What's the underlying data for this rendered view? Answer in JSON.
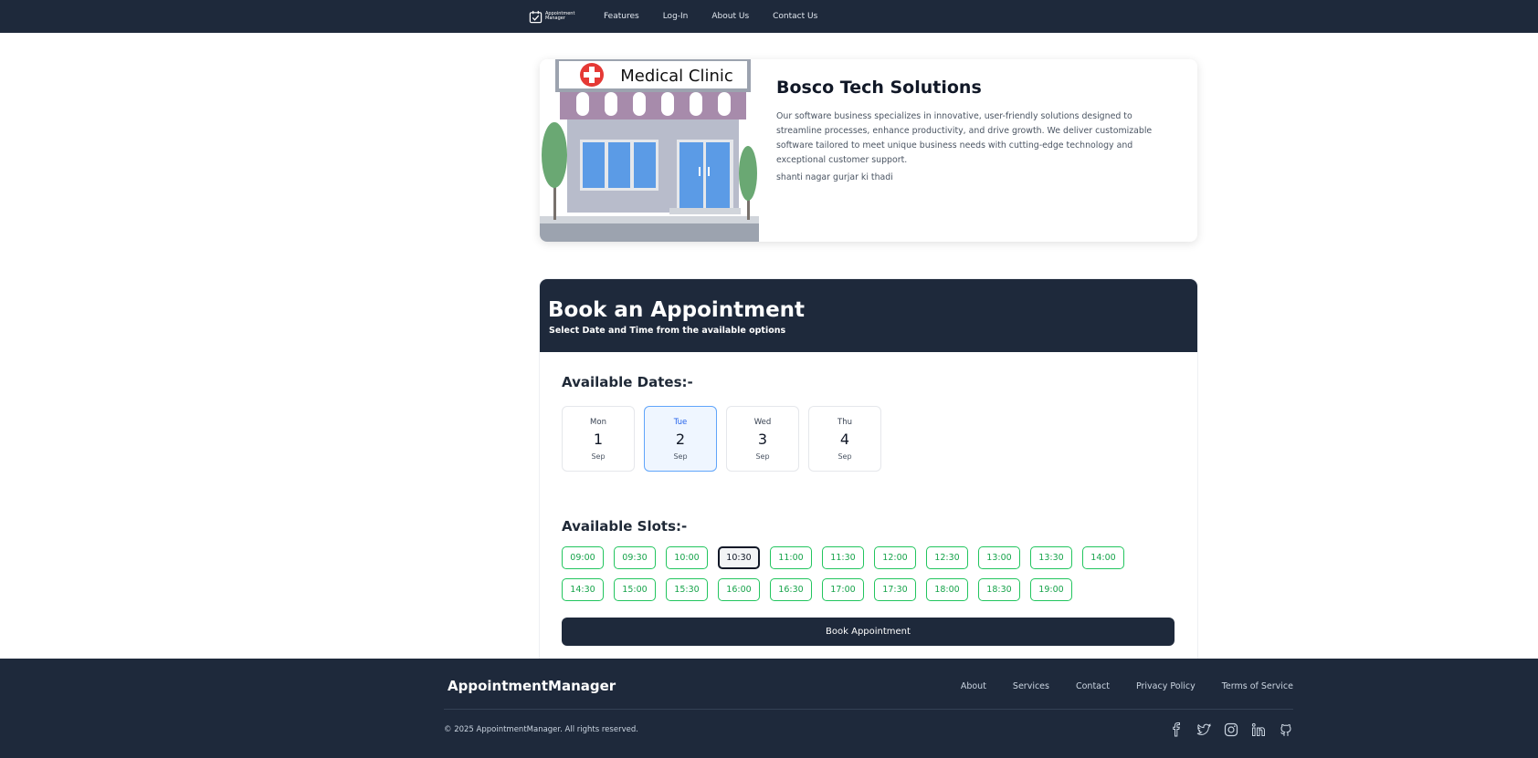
{
  "nav": {
    "logo_text": "Appointment Manager",
    "links": [
      "Features",
      "Log-In",
      "About Us",
      "Contact Us"
    ]
  },
  "business": {
    "image_sign": "Medical Clinic",
    "name": "Bosco Tech Solutions",
    "description": "Our software business specializes in innovative, user-friendly solutions designed to streamline processes, enhance productivity, and drive growth. We deliver customizable software tailored to meet unique business needs with cutting-edge technology and exceptional customer support.",
    "address": "shanti nagar gurjar ki thadi"
  },
  "booking": {
    "title": "Book an Appointment",
    "subtitle": "Select Date and Time from the available options",
    "dates_heading": "Available Dates:-",
    "dates": [
      {
        "dow": "Mon",
        "day": "1",
        "month": "Sep",
        "selected": false
      },
      {
        "dow": "Tue",
        "day": "2",
        "month": "Sep",
        "selected": true
      },
      {
        "dow": "Wed",
        "day": "3",
        "month": "Sep",
        "selected": false
      },
      {
        "dow": "Thu",
        "day": "4",
        "month": "Sep",
        "selected": false
      }
    ],
    "slots_heading": "Available Slots:-",
    "slots": [
      "09:00",
      "09:30",
      "10:00",
      "10:30",
      "11:00",
      "11:30",
      "12:00",
      "12:30",
      "13:00",
      "13:30",
      "14:00",
      "14:30",
      "15:00",
      "15:30",
      "16:00",
      "16:30",
      "17:00",
      "17:30",
      "18:00",
      "18:30",
      "19:00"
    ],
    "selected_slot": "10:30",
    "book_button": "Book Appointment"
  },
  "footer": {
    "brand": "AppointmentManager",
    "links": [
      "About",
      "Services",
      "Contact",
      "Privacy Policy",
      "Terms of Service"
    ],
    "copyright": "© 2025 AppointmentManager. All rights reserved.",
    "social_icons": [
      "facebook-icon",
      "twitter-icon",
      "instagram-icon",
      "linkedin-icon",
      "github-icon"
    ]
  },
  "colors": {
    "navy": "#1e293b",
    "slot_green": "#22c55e",
    "selected_blue": "#60a5fa"
  }
}
